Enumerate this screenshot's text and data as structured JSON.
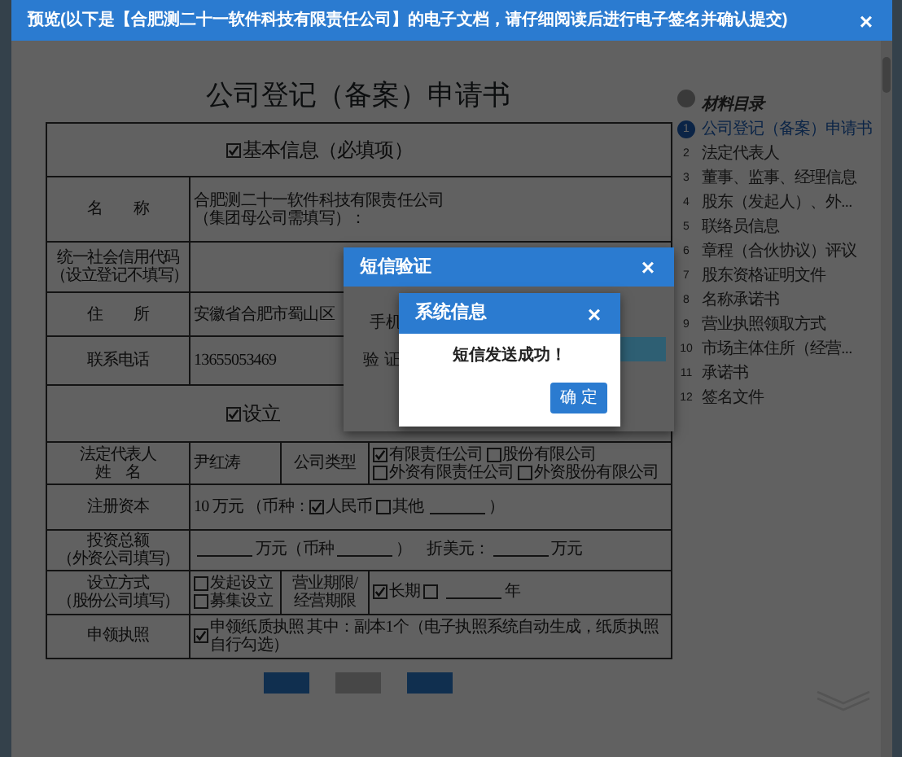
{
  "preview_dialog": {
    "title": "预览(以下是【合肥测二十一软件科技有限责任公司】的电子文档，请仔细阅读后进行电子签名并确认提交)",
    "close": "×"
  },
  "document": {
    "title": "公司登记（备案）申请书",
    "rows": [
      {
        "kind": "section",
        "checked": true,
        "text": "基本信息（必填项）"
      },
      {
        "kind": "row",
        "cells": [
          {
            "kind": "label",
            "parts": [
              {
                "kind": "text",
                "text": "名　　称"
              }
            ]
          },
          {
            "kind": "value",
            "parts": [
              {
                "kind": "text",
                "text": "合肥测二十一软件科技有限责任公司"
              },
              {
                "kind": "break"
              },
              {
                "kind": "text",
                "text": "（集团母公司需填写）："
              }
            ]
          }
        ]
      },
      {
        "kind": "row",
        "cells": [
          {
            "kind": "label",
            "parts": [
              {
                "kind": "text",
                "text": "统一社会信用代码"
              },
              {
                "kind": "break"
              },
              {
                "kind": "text",
                "text": "（设立登记不填写）"
              }
            ]
          },
          {
            "kind": "value"
          }
        ]
      },
      {
        "kind": "row",
        "cells": [
          {
            "kind": "label",
            "parts": [
              {
                "kind": "text",
                "text": "住　　所"
              }
            ]
          },
          {
            "kind": "value",
            "parts": [
              {
                "kind": "text",
                "text": "安徽省合肥市蜀山区"
              }
            ]
          }
        ]
      },
      {
        "kind": "row",
        "cells": [
          {
            "kind": "label",
            "parts": [
              {
                "kind": "text",
                "text": "联系电话"
              }
            ]
          },
          {
            "kind": "value",
            "parts": [
              {
                "kind": "text",
                "text": "13655053469"
              }
            ]
          }
        ]
      },
      {
        "kind": "section",
        "checked": true,
        "text": "设立"
      },
      {
        "kind": "row",
        "cells": [
          {
            "kind": "label",
            "parts": [
              {
                "kind": "text",
                "text": "法定代表人"
              },
              {
                "kind": "break"
              },
              {
                "kind": "text",
                "text": "姓　名"
              }
            ]
          },
          {
            "kind": "value",
            "parts": [
              {
                "kind": "text",
                "text": "尹红涛"
              }
            ]
          },
          {
            "kind": "label",
            "parts": [
              {
                "kind": "text",
                "text": "公司类型"
              }
            ]
          },
          {
            "kind": "value",
            "parts": [
              {
                "kind": "checkbox",
                "checked": true,
                "text": "有限责任公司"
              },
              {
                "kind": "checkbox",
                "checked": false,
                "text": "股份有限公司"
              },
              {
                "kind": "break"
              },
              {
                "kind": "checkbox",
                "checked": false,
                "text": "外资有限责任公司"
              },
              {
                "kind": "checkbox",
                "checked": false,
                "text": "外资股份有限公司"
              }
            ]
          }
        ]
      },
      {
        "kind": "row",
        "cells": [
          {
            "kind": "label",
            "parts": [
              {
                "kind": "text",
                "text": "注册资本"
              }
            ]
          },
          {
            "kind": "value",
            "parts": [
              {
                "kind": "text",
                "text": "10 万元 （币种："
              },
              {
                "kind": "checkbox",
                "checked": true,
                "text": "人民币"
              },
              {
                "kind": "checkbox",
                "checked": false,
                "text": "其他"
              },
              {
                "kind": "blank"
              },
              {
                "kind": "text",
                "text": "）"
              }
            ]
          }
        ]
      },
      {
        "kind": "row",
        "cells": [
          {
            "kind": "label",
            "parts": [
              {
                "kind": "text",
                "text": "投资总额"
              },
              {
                "kind": "break"
              },
              {
                "kind": "text",
                "text": "（外资公司填写）"
              }
            ]
          },
          {
            "kind": "value",
            "parts": [
              {
                "kind": "blank"
              },
              {
                "kind": "text",
                "text": "万元（币种"
              },
              {
                "kind": "blank"
              },
              {
                "kind": "text",
                "text": "）　折美元："
              },
              {
                "kind": "blank"
              },
              {
                "kind": "text",
                "text": "万元"
              }
            ]
          }
        ]
      },
      {
        "kind": "row",
        "cells": [
          {
            "kind": "label",
            "parts": [
              {
                "kind": "text",
                "text": "设立方式"
              },
              {
                "kind": "break"
              },
              {
                "kind": "text",
                "text": "（股份公司填写）"
              }
            ]
          },
          {
            "kind": "value",
            "parts": [
              {
                "kind": "checkbox",
                "checked": false,
                "text": "发起设立"
              },
              {
                "kind": "break"
              },
              {
                "kind": "checkbox",
                "checked": false,
                "text": "募集设立"
              }
            ]
          },
          {
            "kind": "label",
            "parts": [
              {
                "kind": "text",
                "text": "营业期限/"
              },
              {
                "kind": "break"
              },
              {
                "kind": "text",
                "text": "经营期限"
              }
            ]
          },
          {
            "kind": "value",
            "parts": [
              {
                "kind": "checkbox",
                "checked": true,
                "text": "长期"
              },
              {
                "kind": "checkbox",
                "checked": false
              },
              {
                "kind": "blank"
              },
              {
                "kind": "text",
                "text": "年"
              }
            ]
          }
        ]
      },
      {
        "kind": "row",
        "cells": [
          {
            "kind": "label",
            "parts": [
              {
                "kind": "text",
                "text": "申领执照"
              }
            ]
          },
          {
            "kind": "value",
            "parts": [
              {
                "kind": "checkbox",
                "checked": true,
                "text": "申领纸质执照 其中：副本1个（电子执照系统自动生成，纸质执照自行勾选）"
              }
            ]
          }
        ]
      }
    ]
  },
  "buttons": [
    {
      "kind": "primary"
    },
    {
      "kind": "secondary"
    },
    {
      "kind": "primary"
    }
  ],
  "sidebar": {
    "title": "材料目录",
    "items": [
      {
        "number": "1",
        "label": "公司登记（备案）申请书",
        "selected": true
      },
      {
        "number": "2",
        "label": "法定代表人",
        "selected": false
      },
      {
        "number": "3",
        "label": "董事、监事、经理信息",
        "selected": false
      },
      {
        "number": "4",
        "label": "股东（发起人）、外...",
        "selected": false
      },
      {
        "number": "5",
        "label": "联络员信息",
        "selected": false
      },
      {
        "number": "6",
        "label": "章程（合伙协议）评议",
        "selected": false
      },
      {
        "number": "7",
        "label": "股东资格证明文件",
        "selected": false
      },
      {
        "number": "8",
        "label": "名称承诺书",
        "selected": false
      },
      {
        "number": "9",
        "label": "营业执照领取方式",
        "selected": false
      },
      {
        "number": "10",
        "label": "市场主体住所（经营...",
        "selected": false
      },
      {
        "number": "11",
        "label": "承诺书",
        "selected": false
      },
      {
        "number": "12",
        "label": "签名文件",
        "selected": false
      }
    ]
  },
  "sms_dialog": {
    "title": "短信验证",
    "close": "×",
    "fields": [
      {
        "label": "手机"
      },
      {
        "label": "验 证"
      }
    ]
  },
  "message_dialog": {
    "title": "系统信息",
    "close": "×",
    "message": "短信发送成功！",
    "button": "确 定"
  }
}
